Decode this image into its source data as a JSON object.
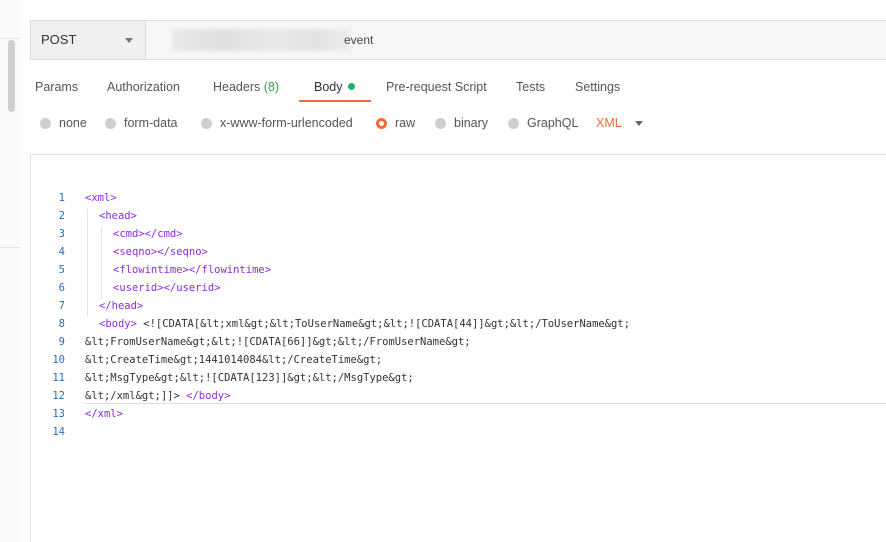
{
  "request": {
    "method": "POST",
    "url_suffix": "event"
  },
  "tabs": [
    {
      "label": "Params"
    },
    {
      "label": "Authorization"
    },
    {
      "label": "Headers",
      "count": "(8)"
    },
    {
      "label": "Body"
    },
    {
      "label": "Pre-request Script"
    },
    {
      "label": "Tests"
    },
    {
      "label": "Settings"
    }
  ],
  "body_types": [
    {
      "label": "none",
      "checked": false
    },
    {
      "label": "form-data",
      "checked": false
    },
    {
      "label": "x-www-form-urlencoded",
      "checked": false
    },
    {
      "label": "raw",
      "checked": true
    },
    {
      "label": "binary",
      "checked": false
    },
    {
      "label": "GraphQL",
      "checked": false
    }
  ],
  "raw_format": "XML",
  "colors": {
    "accent": "#f26b3a",
    "green": "#27ae60",
    "tag": "#8a2be2",
    "line_number": "#2a6fb3"
  },
  "code": [
    {
      "n": "1",
      "tag1": "<xml>",
      "text": "",
      "tag2": ""
    },
    {
      "n": "2",
      "tag1": "<head>",
      "text": "",
      "tag2": ""
    },
    {
      "n": "3",
      "tag1": "<cmd>",
      "text": "",
      "tag2": "</cmd>"
    },
    {
      "n": "4",
      "tag1": "<seqno>",
      "text": "",
      "tag2": "</seqno>"
    },
    {
      "n": "5",
      "tag1": "<flowintime>",
      "text": "",
      "tag2": "</flowintime>"
    },
    {
      "n": "6",
      "tag1": "<userid>",
      "text": "",
      "tag2": "</userid>"
    },
    {
      "n": "7",
      "tag1": "</head>",
      "text": "",
      "tag2": ""
    },
    {
      "n": "8",
      "tag1": "<body>",
      "text": " <![CDATA[&lt;xml&gt;&lt;ToUserName&gt;&lt;![CDATA[44]]&gt;&lt;/ToUserName&gt;",
      "tag2": ""
    },
    {
      "n": "9",
      "tag1": "",
      "text": "&lt;FromUserName&gt;&lt;![CDATA[66]]&gt;&lt;/FromUserName&gt;",
      "tag2": ""
    },
    {
      "n": "10",
      "tag1": "",
      "text": "&lt;CreateTime&gt;1441014084&lt;/CreateTime&gt;",
      "tag2": ""
    },
    {
      "n": "11",
      "tag1": "",
      "text": "&lt;MsgType&gt;&lt;![CDATA[123]]&gt;&lt;/MsgType&gt;",
      "tag2": ""
    },
    {
      "n": "12",
      "tag1": "",
      "text": "&lt;/xml&gt;]]> ",
      "tag2": "</body>"
    },
    {
      "n": "13",
      "tag1": "</xml>",
      "text": "",
      "tag2": ""
    },
    {
      "n": "14",
      "tag1": "",
      "text": "",
      "tag2": ""
    }
  ]
}
